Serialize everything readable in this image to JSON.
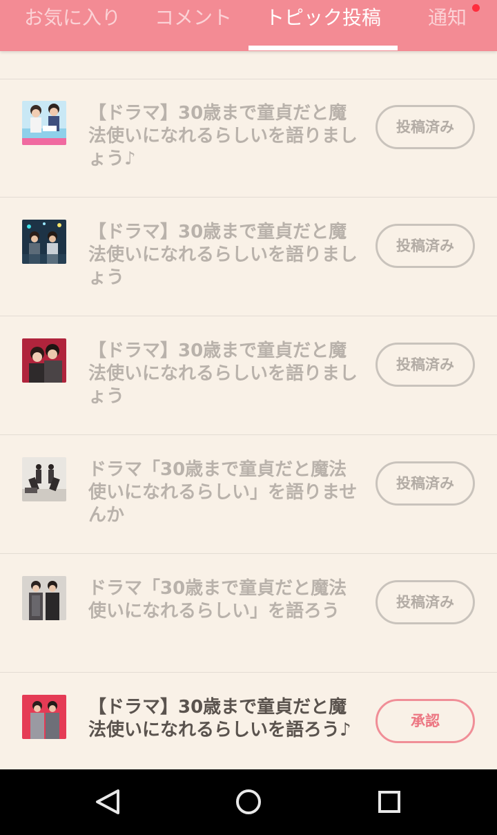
{
  "tabs": [
    {
      "label": "お気に入り",
      "active": false
    },
    {
      "label": "コメント",
      "active": false
    },
    {
      "label": "トピック投稿",
      "active": true
    },
    {
      "label": "通知",
      "active": false,
      "badge": true
    }
  ],
  "colors": {
    "accent": "#f38b94",
    "badge": "#ff2d3d",
    "background": "#f9f1e7"
  },
  "posts": [
    {
      "title": "【ドラマ】30歳まで童貞だと魔法使いになれるらしいを語りましょう♪",
      "status": "投稿済み",
      "thumb": "drama-photo-1"
    },
    {
      "title": "【ドラマ】30歳まで童貞だと魔法使いになれるらしいを語りましょう",
      "status": "投稿済み",
      "thumb": "drama-photo-2"
    },
    {
      "title": "【ドラマ】30歳まで童貞だと魔法使いになれるらしいを語りましょう",
      "status": "投稿済み",
      "thumb": "drama-photo-3"
    },
    {
      "title": "ドラマ「30歳まで童貞だと魔法使いになれるらしい」を語りませんか",
      "status": "投稿済み",
      "thumb": "drama-photo-4"
    },
    {
      "title": "ドラマ「30歳まで童貞だと魔法使いになれるらしい」を語ろう",
      "status": "投稿済み",
      "thumb": "drama-photo-5"
    },
    {
      "title": "【ドラマ】30歳まで童貞だと魔法使いになれるらしいを語ろう♪",
      "status": "承認",
      "thumb": "drama-photo-6"
    }
  ],
  "nav": {
    "back": "back-icon",
    "home": "home-icon",
    "recents": "recents-icon"
  }
}
